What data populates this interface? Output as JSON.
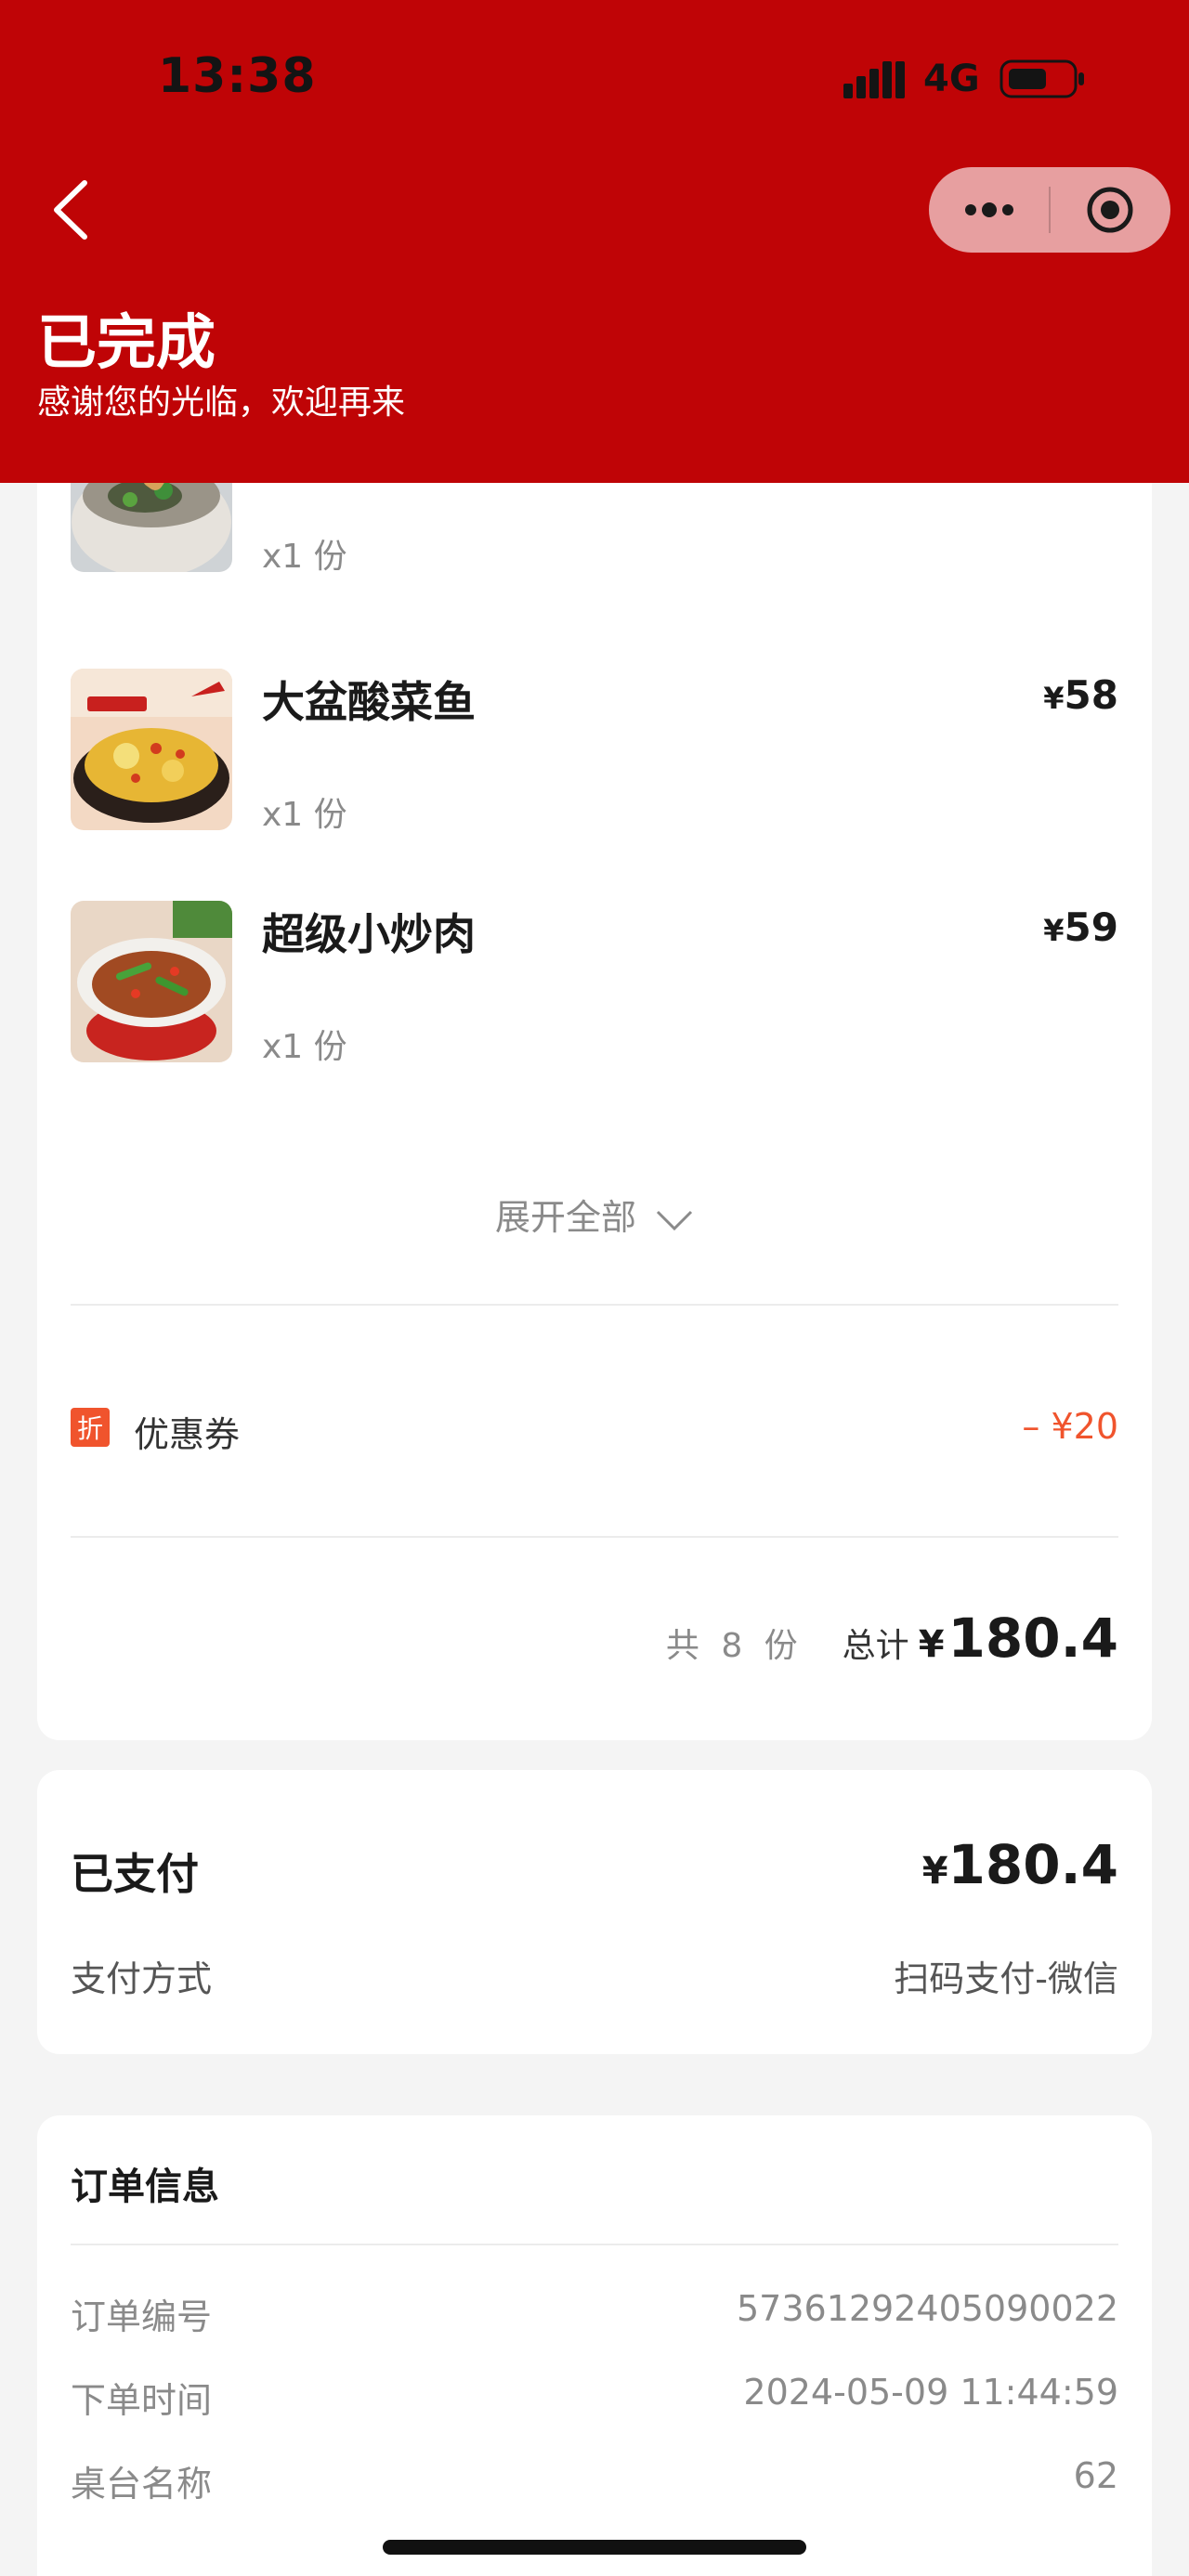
{
  "status_bar": {
    "time": "13:38",
    "network": "4G"
  },
  "header": {
    "title": "已完成",
    "subtitle": "感谢您的光临，欢迎再来"
  },
  "order_items": [
    {
      "name": "",
      "price_currency": "",
      "price": "",
      "qty": "x1 份"
    },
    {
      "name": "大盆酸菜鱼",
      "price_currency": "¥",
      "price": "58",
      "qty": "x1 份"
    },
    {
      "name": "超级小炒肉",
      "price_currency": "¥",
      "price": "59",
      "qty": "x1 份"
    }
  ],
  "expand_label": "展开全部",
  "coupon": {
    "badge": "折",
    "label": "优惠券",
    "value": "– ¥20"
  },
  "summary": {
    "count": "共 8 份",
    "total_label": "总计",
    "currency": "¥",
    "total": "180.4"
  },
  "payment": {
    "title": "已支付",
    "currency": "¥",
    "amount": "180.4",
    "method_label": "支付方式",
    "method_value": "扫码支付-微信"
  },
  "order_info": {
    "title": "订单信息",
    "rows": [
      {
        "key": "订单编号",
        "value": "57361292405090022"
      },
      {
        "key": "下单时间",
        "value": "2024-05-09 11:44:59"
      },
      {
        "key": "桌台名称",
        "value": "62"
      }
    ]
  },
  "colors": {
    "header_red": "#bf0406",
    "accent_orange": "#f0542d"
  }
}
